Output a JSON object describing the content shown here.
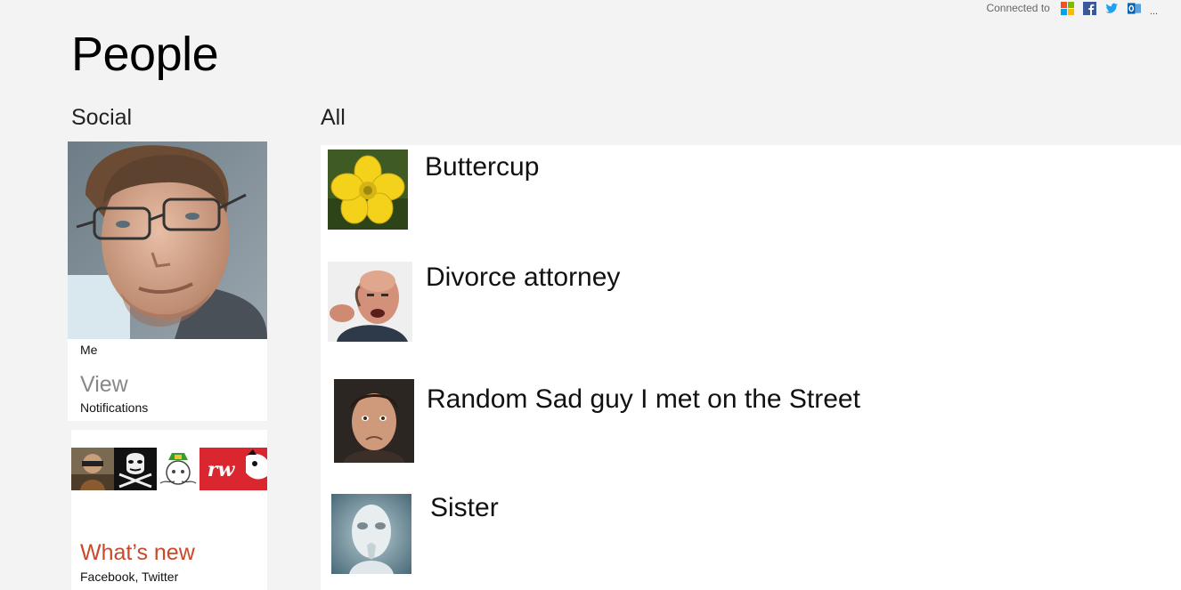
{
  "header": {
    "connected_label": "Connected to",
    "services": [
      "microsoft-icon",
      "facebook-icon",
      "twitter-icon",
      "outlook-icon"
    ],
    "more": "..."
  },
  "page": {
    "title": "People"
  },
  "sections": {
    "social": "Social",
    "all": "All"
  },
  "me_tile": {
    "name": "Me",
    "action": "View",
    "subtitle": "Notifications"
  },
  "whats_new": {
    "title": "What’s new",
    "subtitle": "Facebook, Twitter",
    "avatar_text": "rw"
  },
  "contacts": [
    {
      "name": "Buttercup"
    },
    {
      "name": "Divorce attorney"
    },
    {
      "name": "Random Sad guy I met on the Street"
    },
    {
      "name": "Sister"
    }
  ],
  "colors": {
    "background": "#f3f3f3",
    "tile": "#ffffff",
    "accent_whats_new": "#c9492a",
    "muted_text": "#888888"
  }
}
